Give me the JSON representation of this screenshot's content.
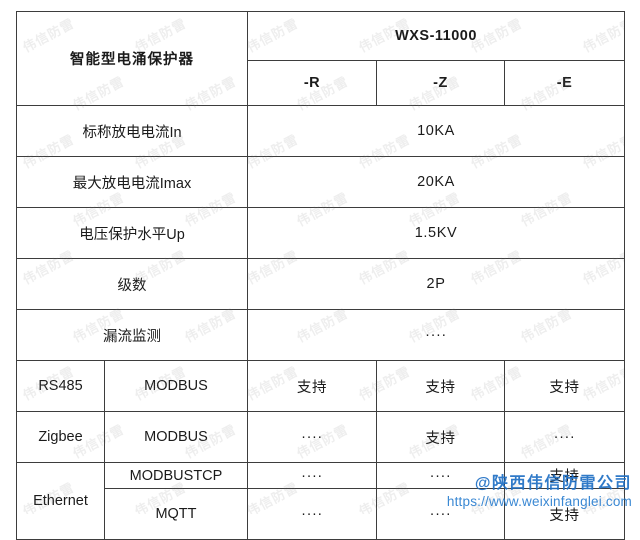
{
  "header": {
    "product_title": "智能型电涌保护器",
    "model": "WXS-11000",
    "variants": [
      "-R",
      "-Z",
      "-E"
    ]
  },
  "spec_rows": [
    {
      "label": "标称放电电流In",
      "value": "10KA",
      "merged": true,
      "gray": false
    },
    {
      "label": "最大放电电流Imax",
      "value": "20KA",
      "merged": true,
      "gray": false
    },
    {
      "label": "电压保护水平Up",
      "value": "1.5KV",
      "merged": true,
      "gray": false
    },
    {
      "label": "级数",
      "value": "2P",
      "merged": true,
      "gray": false
    },
    {
      "label": "漏流监测",
      "value": "····",
      "merged": true,
      "gray": true
    }
  ],
  "comm_rows": [
    {
      "bus": "RS485",
      "bus_rowspan": 1,
      "protocol": "MODBUS",
      "cells": [
        {
          "value": "支持",
          "gray": false
        },
        {
          "value": "支持",
          "gray": false
        },
        {
          "value": "支持",
          "gray": false
        }
      ]
    },
    {
      "bus": "Zigbee",
      "bus_rowspan": 1,
      "protocol": "MODBUS",
      "cells": [
        {
          "value": "····",
          "gray": true
        },
        {
          "value": "支持",
          "gray": false
        },
        {
          "value": "····",
          "gray": true
        }
      ]
    },
    {
      "bus": "Ethernet",
      "bus_rowspan": 2,
      "protocol": "MODBUSTCP",
      "cells": [
        {
          "value": "····",
          "gray": true
        },
        {
          "value": "····",
          "gray": true
        },
        {
          "value": "支持",
          "gray": false
        }
      ]
    },
    {
      "bus": null,
      "bus_rowspan": 0,
      "protocol": "MQTT",
      "cells": [
        {
          "value": "····",
          "gray": true
        },
        {
          "value": "····",
          "gray": true
        },
        {
          "value": "支持",
          "gray": false
        }
      ]
    }
  ],
  "watermark": {
    "name": "@陕西伟信防雷公司",
    "url": "https://www.weixinfanglei.com",
    "tile_text": "伟信防雷"
  },
  "colors": {
    "header_blue": "#00a0f0",
    "gray_cell": "#d6d6d6",
    "border": "#3d3d3d",
    "watermark_blue": "#1f6fc4"
  }
}
